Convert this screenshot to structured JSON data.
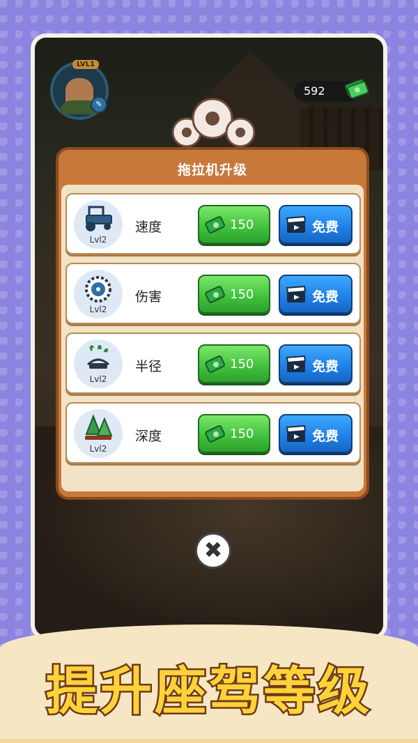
{
  "hud": {
    "level_label": "LVL1",
    "money": "592"
  },
  "panel": {
    "title": "拖拉机升级",
    "items": [
      {
        "label": "速度",
        "level": "Lvl2",
        "cost": "150",
        "free_label": "免费",
        "icon": "tractor-icon"
      },
      {
        "label": "伤害",
        "level": "Lvl2",
        "cost": "150",
        "free_label": "免费",
        "icon": "saw-blade-icon"
      },
      {
        "label": "半径",
        "level": "Lvl2",
        "cost": "150",
        "free_label": "免费",
        "icon": "grass-cutter-icon"
      },
      {
        "label": "深度",
        "level": "Lvl2",
        "cost": "150",
        "free_label": "免费",
        "icon": "trees-icon"
      }
    ]
  },
  "close_icon": "close-icon",
  "banner": {
    "text": "提升座驾等级"
  },
  "colors": {
    "panel": "#c8793a",
    "cash_button": "#3fbf3b",
    "free_button": "#1e7fe6",
    "banner_text": "#ffd23a",
    "background": "#8b84e0"
  }
}
